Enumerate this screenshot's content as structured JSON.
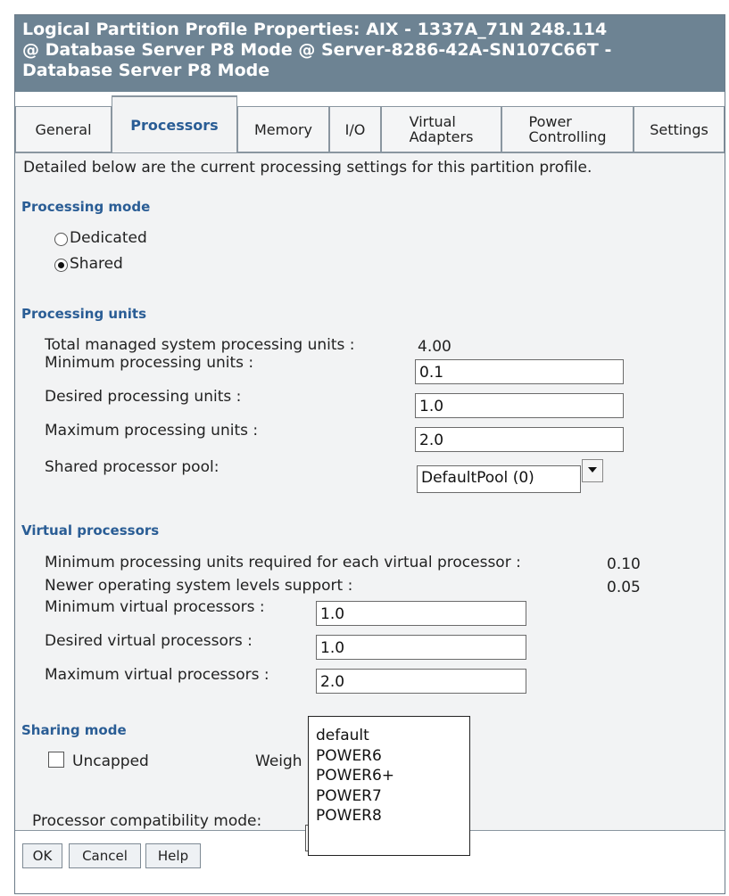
{
  "window": {
    "title_lines": [
      "Logical Partition Profile Properties: AIX - 1337A_71N 248.114",
      "@ Database Server P8 Mode @ Server-8286-42A-SN107C66T -",
      "Database Server P8 Mode"
    ]
  },
  "tabs": [
    {
      "label": "General"
    },
    {
      "label": "Processors"
    },
    {
      "label": "Memory"
    },
    {
      "label": "I/O"
    },
    {
      "label_lines": [
        "Virtual",
        "Adapters"
      ]
    },
    {
      "label_lines": [
        "Power",
        "Controlling"
      ]
    },
    {
      "label": "Settings"
    }
  ],
  "intro": "Detailed below are the current processing settings for this partition profile.",
  "processing_mode": {
    "heading": "Processing mode",
    "options": [
      {
        "label": "Dedicated",
        "checked": false
      },
      {
        "label": "Shared",
        "checked": true
      }
    ]
  },
  "processing_units": {
    "heading": "Processing units",
    "total_label": "Total managed system processing units :",
    "total_value": "4.00",
    "min_label": "Minimum processing units :",
    "min_value": "0.1",
    "desired_label": "Desired processing units :",
    "desired_value": "1.0",
    "max_label": "Maximum processing units :",
    "max_value": "2.0",
    "pool_label": "Shared processor pool:",
    "pool_value": "DefaultPool (0)"
  },
  "virtual_processors": {
    "heading": "Virtual processors",
    "min_units_label": "Minimum processing units required for each virtual processor :",
    "min_units_value": "0.10",
    "newer_label": "Newer operating system levels support :",
    "newer_value": "0.05",
    "min_label": "Minimum virtual processors :",
    "min_value": "1.0",
    "desired_label": "Desired virtual processors :",
    "desired_value": "1.0",
    "max_label": "Maximum virtual processors :",
    "max_value": "2.0"
  },
  "sharing_mode": {
    "heading": "Sharing mode",
    "uncapped_label": "Uncapped",
    "uncapped_checked": false,
    "weight_label": "Weigh"
  },
  "compat": {
    "label": "Processor compatibility mode:",
    "options": [
      "default",
      "POWER6",
      "POWER6+",
      "POWER7",
      "POWER8"
    ]
  },
  "buttons": {
    "ok": "OK",
    "cancel": "Cancel",
    "help": "Help"
  }
}
